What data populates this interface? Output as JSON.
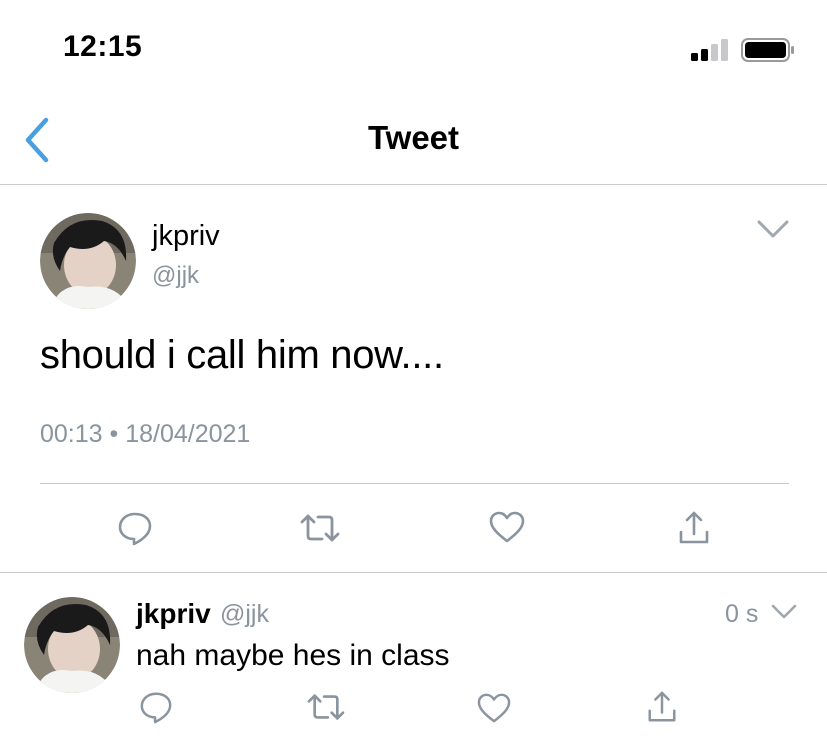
{
  "status_bar": {
    "time": "12:15",
    "signal_icon": "signal-icon",
    "battery_icon": "battery-icon"
  },
  "nav": {
    "title": "Tweet",
    "back_icon": "chevron-left-icon"
  },
  "main_tweet": {
    "name": "jkpriv",
    "handle": "@jjk",
    "text": "should i call him now....",
    "timestamp": "00:13 • 18/04/2021",
    "actions": [
      "reply-icon",
      "retweet-icon",
      "like-icon",
      "share-icon"
    ]
  },
  "reply_tweet": {
    "name": "jkpriv",
    "handle": "@jjk",
    "age": "0 s",
    "text": "nah maybe hes in class",
    "actions": [
      "reply-icon",
      "retweet-icon",
      "like-icon",
      "share-icon"
    ]
  },
  "colors": {
    "accent": "#4a9fe0",
    "icon_gray": "#8a949e",
    "divider": "#c8ccd0"
  }
}
